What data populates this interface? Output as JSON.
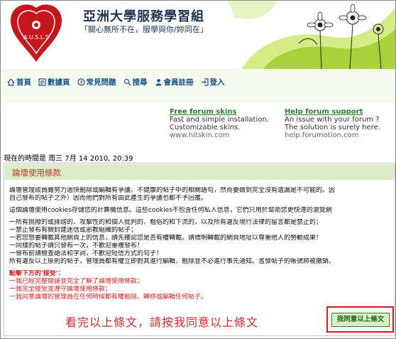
{
  "header": {
    "logo_text": "A.U.S.L.S",
    "title": "亞洲大學服務學習組",
    "subtitle": "「關心無所不在，服學與你/妳同在」"
  },
  "nav": {
    "items": [
      {
        "label": "首頁",
        "icon": "home-icon"
      },
      {
        "label": "數據頁",
        "icon": "portal-icon"
      },
      {
        "label": "常見問題",
        "icon": "faq-icon"
      },
      {
        "label": "搜尋",
        "icon": "search-icon"
      },
      {
        "label": "會員註冊",
        "icon": "register-icon"
      },
      {
        "label": "登入",
        "icon": "login-icon"
      }
    ]
  },
  "ads": [
    {
      "title": "Free forum skins",
      "line1": "Fast and simple installation.",
      "line2": "Customizable skins.",
      "url": "www.hitskin.com"
    },
    {
      "title": "Help forum support",
      "line1": "An issue with your forum ?",
      "line2": "The solution is surely here.",
      "url": "help.forumotion.com"
    }
  ],
  "time_line": "現在的時間是 周三 7月 14 2010, 20:39",
  "terms": {
    "title": "論壇使用條款",
    "para1": [
      "論壇管理成員雖努力過快刪除或編輯有爭議、不健康的帖子中的相關語句，然而要做到完全沒有遺漏是不可能的。因",
      "自己發布的帖子之外）因而他們對所有由此產生的爭議也都不予回覆。"
    ],
    "para2": "這個論壇使用cookies存儲您的計算機信息。這些cookies不包含任何私人信息，它們只用於幫助您更快速的瀏覽網",
    "rules": [
      "一所有挑撥的或誹謗的、攻擊性的和個人批判的、粗俗的和下流的，以及所有違反現行法律的留言都是禁止的；",
      "一禁止發布有關封建迷信或邪教組織的帖子；",
      "一若您想要轉載其他網頁上的信息，請先確認您是否有權轉載。請標明轉載的網頁地址以尊重他人的勞動成果！",
      "一同樣的帖子請只發布一次，不歡迎重複發布！",
      "一發布前請檢查語法和字詞，不歡迎短信方式的句子！",
      "所有違反以上原則的帖子，管理員都有權立即對其進行編輯、刪除並不必進行事先通知。濫發帖子的帳號將被撤銷。"
    ],
    "agree_heading": "點擊下方的'接受'：",
    "agree_items": [
      "一我已經完整閱讀並完全了解了論壇使用條款；",
      "一我完全接受並遵守論壇使用條款；",
      "一我同意論壇的管理員在任何時候都有權刪除、轉移或編輯任何帖子。"
    ]
  },
  "instruction": "看完以上條文，請按我同意以上條文",
  "agree_button": "我同意以上條文",
  "colors": {
    "accent_green": "#dcebc8",
    "warning_red": "#d81e1e",
    "nav_blue": "#1b4f8a"
  }
}
